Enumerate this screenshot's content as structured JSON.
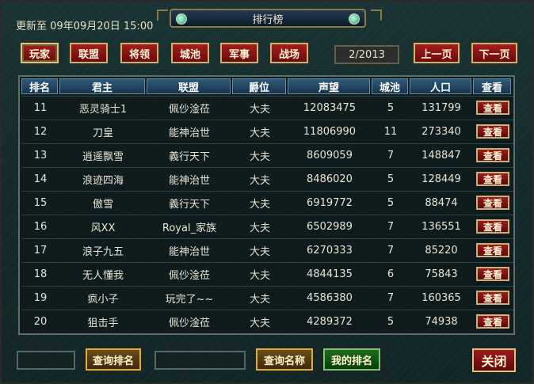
{
  "header": {
    "update_text": "更新至 09年09月20日 15:00",
    "title": "排行榜"
  },
  "tabs": [
    "玩家",
    "联盟",
    "将领",
    "城池",
    "军事",
    "战场"
  ],
  "active_tab_index": 0,
  "pagination": {
    "page_text": "2/2013",
    "prev_label": "上一页",
    "next_label": "下一页"
  },
  "table": {
    "columns": [
      "排名",
      "君主",
      "联盟",
      "爵位",
      "声望",
      "城池",
      "人口",
      "查看"
    ],
    "rows": [
      {
        "rank": "11",
        "name": "恶灵骑士1",
        "alliance": "佩仯淦莅",
        "title": "大夫",
        "prestige": "12083475",
        "cities": "5",
        "population": "131799",
        "view": "查看"
      },
      {
        "rank": "12",
        "name": "刀皇",
        "alliance": "能神治世",
        "title": "大夫",
        "prestige": "11806990",
        "cities": "11",
        "population": "273340",
        "view": "查看"
      },
      {
        "rank": "13",
        "name": "逍遥飘雪",
        "alliance": "義行天下",
        "title": "大夫",
        "prestige": "8609059",
        "cities": "7",
        "population": "148847",
        "view": "查看"
      },
      {
        "rank": "14",
        "name": "浪迹四海",
        "alliance": "能神治世",
        "title": "大夫",
        "prestige": "8486020",
        "cities": "5",
        "population": "128449",
        "view": "查看"
      },
      {
        "rank": "15",
        "name": "傲雪",
        "alliance": "義行天下",
        "title": "大夫",
        "prestige": "6919772",
        "cities": "5",
        "population": "88474",
        "view": "查看"
      },
      {
        "rank": "16",
        "name": "风XX",
        "alliance": "Royal_家族",
        "title": "大夫",
        "prestige": "6502989",
        "cities": "7",
        "population": "136551",
        "view": "查看"
      },
      {
        "rank": "17",
        "name": "浪子九五",
        "alliance": "能神治世",
        "title": "大夫",
        "prestige": "6270333",
        "cities": "7",
        "population": "85220",
        "view": "查看"
      },
      {
        "rank": "18",
        "name": "无人懂我",
        "alliance": "佩仯淦莅",
        "title": "大夫",
        "prestige": "4844135",
        "cities": "6",
        "population": "75843",
        "view": "查看"
      },
      {
        "rank": "19",
        "name": "疯小子",
        "alliance": "玩完了~~",
        "title": "大夫",
        "prestige": "4586380",
        "cities": "7",
        "population": "160365",
        "view": "查看"
      },
      {
        "rank": "20",
        "name": "狙击手",
        "alliance": "佩仯淦莅",
        "title": "大夫",
        "prestige": "4289372",
        "cities": "5",
        "population": "74938",
        "view": "查看"
      }
    ]
  },
  "bottom": {
    "rank_input_value": "",
    "query_rank_label": "查询排名",
    "name_input_value": "",
    "query_name_label": "查询名称",
    "my_rank_label": "我的排名",
    "close_label": "关闭"
  },
  "icons": {
    "title_left": "gem-icon",
    "title_right": "gem-icon"
  }
}
